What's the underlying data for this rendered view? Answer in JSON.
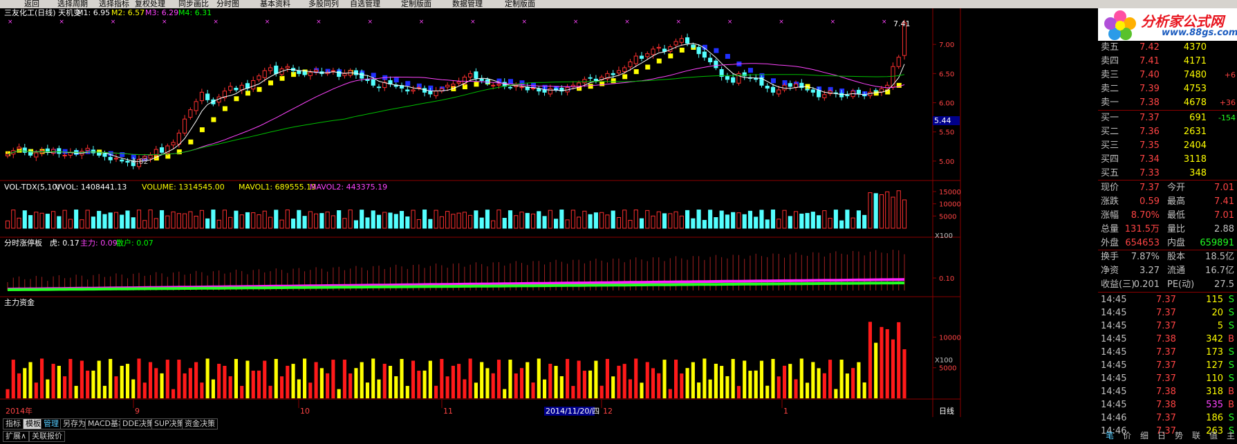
{
  "menu": [
    "返回",
    "选择周期",
    "选择指标",
    "复权处理",
    "同步画比",
    "分时图",
    "基本资料",
    "多股同列",
    "自选管理",
    "定制版面",
    "数据管理",
    "定制版面"
  ],
  "main_header": {
    "title": "三友化工(日线) 天机变",
    "m1": "M1: 6.95",
    "m2": "M2: 6.57",
    "m3": "M3: 6.29",
    "m4": "M4: 6.31",
    "price_marker": "7.41",
    "low_marker": "4.82",
    "cursor_price": "5.44",
    "colors": {
      "m1": "#ffffff",
      "m2": "#ffff00",
      "m3": "#ff44ff",
      "m4": "#00ff00"
    }
  },
  "vol_header": {
    "name": "VOL-TDX(5,10)",
    "vvol": "VVOL: 1408441.13",
    "volume": "VOLUME: 1314545.00",
    "mavol1": "MAVOL1: 689555.19",
    "mavol2": "MAVOL2: 443375.19",
    "unit": "X100"
  },
  "zt_header": {
    "name": "分时涨停板",
    "hu": "虎: 0.17",
    "zhuli": "主力: 0.09",
    "sanhu": "散户: 0.07"
  },
  "money_header": {
    "name": "主力资金",
    "unit": "X100"
  },
  "date_axis": {
    "year": "2014年",
    "m9": "9",
    "m10": "10",
    "m11": "11",
    "cursor_date": "2014/11/20/四",
    "m12": "12",
    "m1": "1",
    "period": "日线"
  },
  "bottom_tabs": [
    "指标",
    "模板",
    "管理",
    "另存为",
    "MACD基本",
    "DDE决策",
    "SUP决策",
    "资金决策"
  ],
  "bottom_tabs2": [
    "扩展∧",
    "关联报价"
  ],
  "side_tabs": [
    "笔",
    "价",
    "细",
    "日",
    "势",
    "联",
    "值",
    "主"
  ],
  "logo": {
    "title": "分析家公式网",
    "url": "www.88gs.com"
  },
  "order_book": [
    {
      "label": "卖五",
      "price": "7.42",
      "vol": "4370",
      "chg": ""
    },
    {
      "label": "卖四",
      "price": "7.41",
      "vol": "4171",
      "chg": ""
    },
    {
      "label": "卖三",
      "price": "7.40",
      "vol": "7480",
      "chg": "+6"
    },
    {
      "label": "卖二",
      "price": "7.39",
      "vol": "4753",
      "chg": ""
    },
    {
      "label": "卖一",
      "price": "7.38",
      "vol": "4678",
      "chg": "+36"
    },
    {
      "label": "买一",
      "price": "7.37",
      "vol": "691",
      "chg": "-154"
    },
    {
      "label": "买二",
      "price": "7.36",
      "vol": "2631",
      "chg": ""
    },
    {
      "label": "买三",
      "price": "7.35",
      "vol": "2404",
      "chg": ""
    },
    {
      "label": "买四",
      "price": "7.34",
      "vol": "3118",
      "chg": ""
    },
    {
      "label": "买五",
      "price": "7.33",
      "vol": "348",
      "chg": ""
    }
  ],
  "stats": [
    {
      "l1": "现价",
      "v1": "7.37",
      "l2": "今开",
      "v2": "7.01"
    },
    {
      "l1": "涨跌",
      "v1": "0.59",
      "l2": "最高",
      "v2": "7.41"
    },
    {
      "l1": "涨幅",
      "v1": "8.70%",
      "l2": "最低",
      "v2": "7.01"
    },
    {
      "l1": "总量",
      "v1": "131.5万",
      "l2": "量比",
      "v2": "2.88"
    },
    {
      "l1": "外盘",
      "v1": "654653",
      "l2": "内盘",
      "v2": "659891"
    },
    {
      "l1": "换手",
      "v1": "7.87%",
      "l2": "股本",
      "v2": "18.5亿"
    },
    {
      "l1": "净资",
      "v1": "3.27",
      "l2": "流通",
      "v2": "16.7亿"
    },
    {
      "l1": "收益(三)",
      "v1": "0.201",
      "l2": "PE(动)",
      "v2": "27.5"
    }
  ],
  "ticks": [
    {
      "time": "14:45",
      "price": "7.37",
      "vol": "115",
      "bs": "S"
    },
    {
      "time": "14:45",
      "price": "7.37",
      "vol": "20",
      "bs": "S"
    },
    {
      "time": "14:45",
      "price": "7.37",
      "vol": "5",
      "bs": "S"
    },
    {
      "time": "14:45",
      "price": "7.38",
      "vol": "342",
      "bs": "B"
    },
    {
      "time": "14:45",
      "price": "7.37",
      "vol": "173",
      "bs": "S"
    },
    {
      "time": "14:45",
      "price": "7.37",
      "vol": "127",
      "bs": "S"
    },
    {
      "time": "14:45",
      "price": "7.37",
      "vol": "110",
      "bs": "S"
    },
    {
      "time": "14:45",
      "price": "7.38",
      "vol": "318",
      "bs": "B"
    },
    {
      "time": "14:45",
      "price": "7.38",
      "vol": "535",
      "bs": "B"
    },
    {
      "time": "14:46",
      "price": "7.37",
      "vol": "186",
      "bs": "S"
    },
    {
      "time": "14:46",
      "price": "7.37",
      "vol": "263",
      "bs": "S"
    }
  ],
  "chart_data": {
    "type": "candlestick",
    "price_axis_ticks": [
      "7.00",
      "6.50",
      "6.00",
      "5.50",
      "5.00"
    ],
    "price_ylim": [
      4.75,
      7.5
    ],
    "vol_axis_ticks": [
      "15000",
      "10000",
      "5000"
    ],
    "zt_axis_ticks": [
      "0.10"
    ],
    "money_axis_ticks": [
      "10000",
      "5000"
    ],
    "close": [
      5.12,
      5.18,
      5.24,
      5.15,
      5.1,
      5.14,
      5.18,
      5.15,
      5.2,
      5.13,
      5.1,
      5.15,
      5.12,
      5.17,
      5.22,
      5.14,
      5.1,
      5.08,
      5.02,
      5.05,
      5.0,
      4.98,
      4.92,
      5.03,
      5.08,
      5.1,
      5.2,
      5.15,
      5.26,
      5.32,
      5.48,
      5.72,
      5.88,
      6.02,
      6.18,
      6.05,
      5.98,
      6.1,
      6.2,
      6.28,
      6.22,
      6.3,
      6.25,
      6.38,
      6.46,
      6.55,
      6.6,
      6.5,
      6.58,
      6.62,
      6.55,
      6.5,
      6.48,
      6.52,
      6.56,
      6.5,
      6.52,
      6.55,
      6.45,
      6.5,
      6.55,
      6.48,
      6.42,
      6.38,
      6.3,
      6.26,
      6.35,
      6.32,
      6.28,
      6.25,
      6.2,
      6.22,
      6.26,
      6.18,
      6.15,
      6.2,
      6.24,
      6.3,
      6.32,
      6.36,
      6.44,
      6.5,
      6.42,
      6.38,
      6.33,
      6.3,
      6.32,
      6.28,
      6.26,
      6.3,
      6.27,
      6.22,
      6.25,
      6.2,
      6.18,
      6.24,
      6.22,
      6.2,
      6.26,
      6.3,
      6.34,
      6.4,
      6.42,
      6.38,
      6.44,
      6.5,
      6.48,
      6.55,
      6.6,
      6.7,
      6.8,
      6.76,
      6.84,
      6.92,
      6.95,
      6.88,
      6.96,
      7.05,
      7.1,
      7.02,
      6.95,
      6.84,
      6.78,
      6.7,
      6.6,
      6.45,
      6.4,
      6.35,
      6.5,
      6.46,
      6.42,
      6.4,
      6.3,
      6.25,
      6.18,
      6.22,
      6.3,
      6.28,
      6.32,
      6.26,
      6.22,
      6.18,
      6.1,
      6.14,
      6.2,
      6.16,
      6.1,
      6.12,
      6.2,
      6.16,
      6.12,
      6.18,
      6.2,
      6.24,
      6.3,
      6.62,
      6.78,
      7.37
    ]
  }
}
